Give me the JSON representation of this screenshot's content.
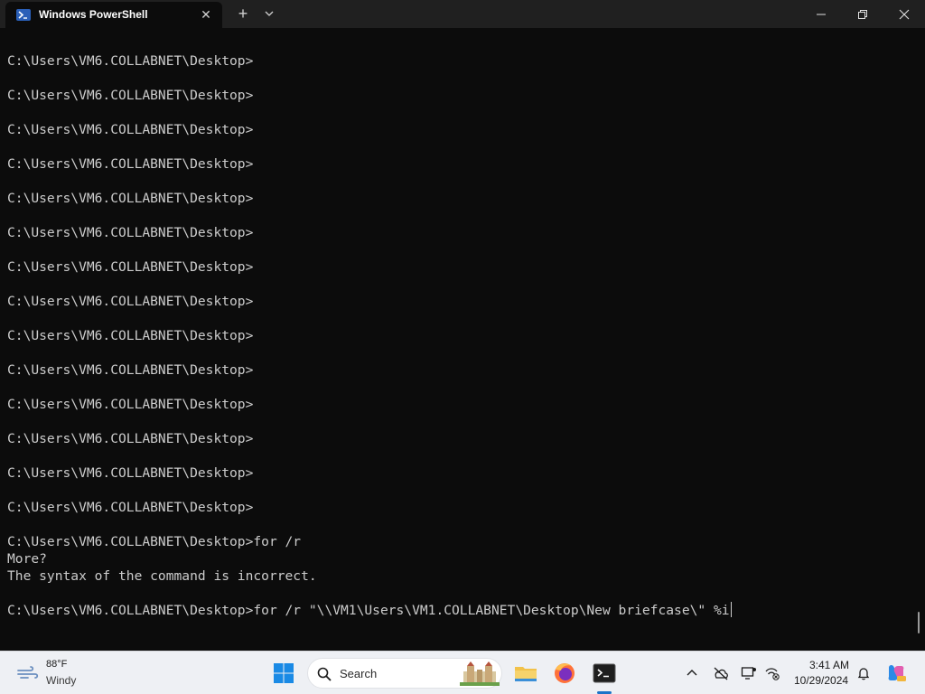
{
  "window": {
    "tab_title": "Windows PowerShell",
    "new_tab_symbol": "+",
    "close_symbol": "✕"
  },
  "terminal": {
    "prompt": "C:\\Users\\VM6.COLLABNET\\Desktop>",
    "lines": [
      "C:\\Users\\VM6.COLLABNET\\Desktop>",
      "C:\\Users\\VM6.COLLABNET\\Desktop>",
      "C:\\Users\\VM6.COLLABNET\\Desktop>",
      "C:\\Users\\VM6.COLLABNET\\Desktop>",
      "C:\\Users\\VM6.COLLABNET\\Desktop>",
      "C:\\Users\\VM6.COLLABNET\\Desktop>",
      "C:\\Users\\VM6.COLLABNET\\Desktop>",
      "C:\\Users\\VM6.COLLABNET\\Desktop>",
      "C:\\Users\\VM6.COLLABNET\\Desktop>",
      "C:\\Users\\VM6.COLLABNET\\Desktop>",
      "C:\\Users\\VM6.COLLABNET\\Desktop>",
      "C:\\Users\\VM6.COLLABNET\\Desktop>",
      "C:\\Users\\VM6.COLLABNET\\Desktop>",
      "C:\\Users\\VM6.COLLABNET\\Desktop>",
      "C:\\Users\\VM6.COLLABNET\\Desktop>for /r",
      "More?",
      "The syntax of the command is incorrect.",
      "C:\\Users\\VM6.COLLABNET\\Desktop>for /r \"\\\\VM1\\Users\\VM1.COLLABNET\\Desktop\\New briefcase\\\" %i"
    ]
  },
  "taskbar": {
    "weather_temp": "88°F",
    "weather_desc": "Windy",
    "search_placeholder": "Search",
    "clock_time": "3:41 AM",
    "clock_date": "10/29/2024",
    "apps": [
      "start-icon",
      "file-explorer-icon",
      "firefox-icon",
      "terminal-icon"
    ],
    "tray": [
      "chevron-up-icon",
      "onedrive-icon",
      "display-icon",
      "network-icon",
      "bell-icon",
      "copilot-icon"
    ]
  },
  "colors": {
    "terminal_bg": "#0c0c0c",
    "terminal_text": "#cccccc",
    "titlebar_bg": "#202020",
    "taskbar_bg": "#eef0f4",
    "accent": "#1a73c8"
  }
}
